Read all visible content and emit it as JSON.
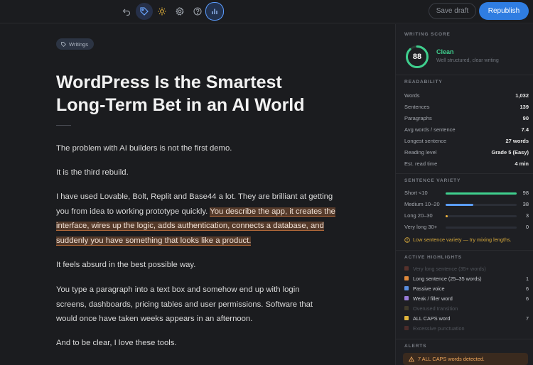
{
  "toolbar": {
    "icons": [
      "undo-icon",
      "tag-icon",
      "sun-icon",
      "gear-icon",
      "help-icon",
      "stats-icon"
    ],
    "save_draft_label": "Save draft",
    "publish_label": "Republish"
  },
  "editor": {
    "tag": "Writings",
    "title": "WordPress Is the Smartest Long-Term Bet in an AI World",
    "paragraphs": {
      "p1": "The problem with AI builders is not the first demo.",
      "p2": "It is the third rebuild.",
      "p3_plain": "I have used Lovable, Bolt, Replit and Base44 a lot. They are brilliant at getting you from idea to working prototype quickly. ",
      "p3_highlight": "You describe the app, it creates the interface, wires up the logic, adds authentication, connects a database, and suddenly you have something that looks like a product.",
      "p4": "It feels absurd in the best possible way.",
      "p5": "You type a paragraph into a text box and somehow end up with login screens, dashboards, pricing tables and user permissions. Software that would once have taken weeks appears in an afternoon.",
      "p6": "And to be clear, I love these tools."
    }
  },
  "sidebar": {
    "score_title": "WRITING SCORE",
    "score": "88",
    "score_value": 88,
    "score_label": "Clean",
    "score_sub": "Well structured, clear writing",
    "readability_title": "READABILITY",
    "stats": [
      {
        "k": "Words",
        "v": "1,032"
      },
      {
        "k": "Sentences",
        "v": "139"
      },
      {
        "k": "Paragraphs",
        "v": "90"
      },
      {
        "k": "Avg words / sentence",
        "v": "7.4"
      },
      {
        "k": "Longest sentence",
        "v": "27 words"
      },
      {
        "k": "Reading level",
        "v": "Grade 5 (Easy)"
      },
      {
        "k": "Est. read time",
        "v": "4 min"
      }
    ],
    "variety_title": "SENTENCE VARIETY",
    "variety": [
      {
        "label": "Short <10",
        "count": "98",
        "value": 98,
        "color": "#3fcf8e"
      },
      {
        "label": "Medium 10–20",
        "count": "38",
        "value": 38,
        "color": "#5b9dff"
      },
      {
        "label": "Long 20–30",
        "count": "3",
        "value": 3,
        "color": "#f0b43c"
      },
      {
        "label": "Very long 30+",
        "count": "0",
        "value": 0,
        "color": "#e05a5a"
      }
    ],
    "variety_warning": "Low sentence variety — try mixing lengths.",
    "highlights_title": "ACTIVE HIGHLIGHTS",
    "highlights": [
      {
        "name": "Very long sentence (35+ words)",
        "count": "",
        "color": "#c0533b",
        "dim": true
      },
      {
        "name": "Long sentence (25–35 words)",
        "count": "1",
        "color": "#e08a3c",
        "dim": false
      },
      {
        "name": "Passive voice",
        "count": "6",
        "color": "#5b8fe0",
        "dim": false
      },
      {
        "name": "Weak / filler word",
        "count": "6",
        "color": "#9a7cd8",
        "dim": false
      },
      {
        "name": "Overused transition",
        "count": "",
        "color": "#7a6a3a",
        "dim": true
      },
      {
        "name": "ALL CAPS word",
        "count": "7",
        "color": "#e0b43c",
        "dim": false
      },
      {
        "name": "Excessive punctuation",
        "count": "",
        "color": "#a0443a",
        "dim": true
      }
    ],
    "alerts_title": "ALERTS",
    "alert_text": "7 ALL CAPS words detected."
  }
}
